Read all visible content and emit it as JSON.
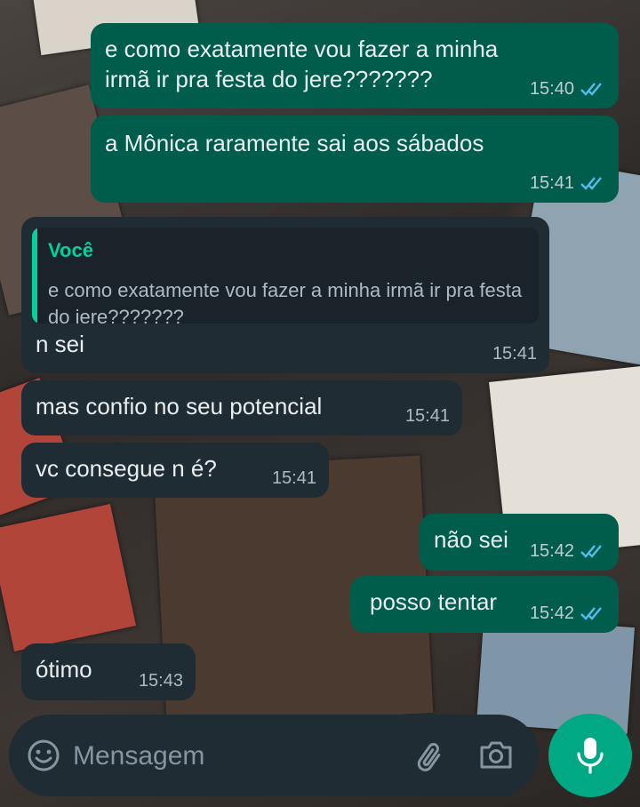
{
  "chat": {
    "messages": [
      {
        "dir": "out",
        "text_lines": [
          "e como exatamente vou fazer a minha",
          "irmã ir pra festa do jere???????"
        ],
        "time": "15:40",
        "status": "read"
      },
      {
        "dir": "out",
        "text_lines": [
          "a Mônica raramente sai aos sábados"
        ],
        "time": "15:41",
        "status": "read"
      },
      {
        "dir": "in",
        "quote": {
          "author": "Você",
          "text": "e como exatamente vou fazer a minha irmã ir pra festa do jere???????"
        },
        "text_lines": [
          "n sei"
        ],
        "time": "15:41"
      },
      {
        "dir": "in",
        "text_lines": [
          "mas confio no seu potencial"
        ],
        "time": "15:41"
      },
      {
        "dir": "in",
        "text_lines": [
          "vc consegue n é?"
        ],
        "time": "15:41"
      },
      {
        "dir": "out",
        "text_lines": [
          "não sei"
        ],
        "time": "15:42",
        "status": "read"
      },
      {
        "dir": "out",
        "text_lines": [
          "posso tentar"
        ],
        "time": "15:42",
        "status": "read"
      },
      {
        "dir": "in",
        "text_lines": [
          "ótimo"
        ],
        "time": "15:43"
      }
    ]
  },
  "input": {
    "placeholder": "Mensagem",
    "icons": [
      "emoji-icon",
      "attach-icon",
      "camera-icon",
      "mic-icon"
    ]
  },
  "colors": {
    "outgoing_bubble": "#005c4b",
    "incoming_bubble": "#202c33",
    "read_ticks": "#53bdeb",
    "accent": "#00a884",
    "quote_author": "#06cf9c"
  }
}
